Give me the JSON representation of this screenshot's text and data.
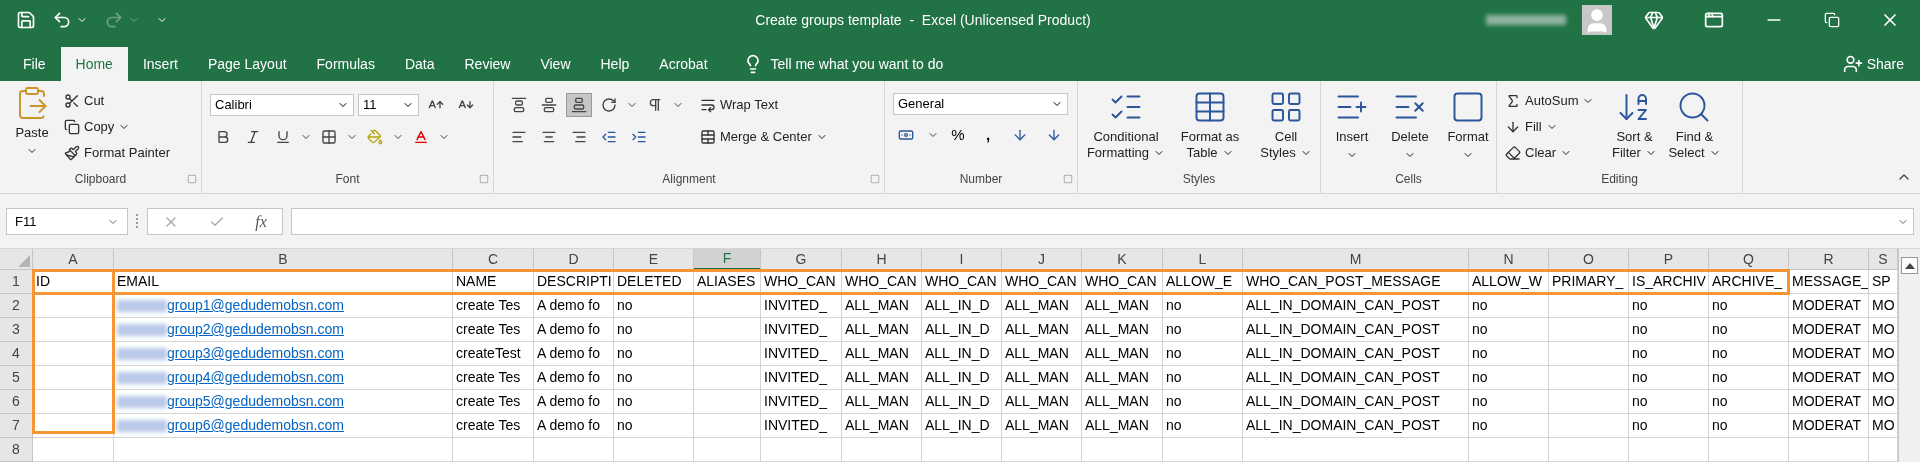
{
  "window": {
    "title": "Create groups template  -  Excel (Unlicensed Product)"
  },
  "quick_access": {
    "redo_disabled": true
  },
  "tabs": [
    {
      "label": "File",
      "selected": false
    },
    {
      "label": "Home",
      "selected": true
    },
    {
      "label": "Insert",
      "selected": false
    },
    {
      "label": "Page Layout",
      "selected": false
    },
    {
      "label": "Formulas",
      "selected": false
    },
    {
      "label": "Data",
      "selected": false
    },
    {
      "label": "Review",
      "selected": false
    },
    {
      "label": "View",
      "selected": false
    },
    {
      "label": "Help",
      "selected": false
    },
    {
      "label": "Acrobat",
      "selected": false
    }
  ],
  "tell_me": "Tell me what you want to do",
  "share": "Share",
  "clipboard": {
    "label": "Clipboard",
    "paste": "Paste",
    "cut": "Cut",
    "copy": "Copy",
    "format_painter": "Format Painter"
  },
  "font": {
    "label": "Font",
    "font_name": "Calibri",
    "font_size": "11"
  },
  "alignment": {
    "label": "Alignment",
    "wrap_text": "Wrap Text",
    "merge_center": "Merge & Center",
    "bottom_align_on": true
  },
  "number": {
    "label": "Number",
    "format": "General",
    "percent": "%",
    "comma": ","
  },
  "styles": {
    "label": "Styles",
    "buttons": [
      [
        "Conditional",
        "Formatting"
      ],
      [
        "Format as",
        "Table"
      ],
      [
        "Cell",
        "Styles"
      ]
    ]
  },
  "cells": {
    "label": "Cells",
    "buttons": [
      "Insert",
      "Delete",
      "Format"
    ]
  },
  "editing": {
    "label": "Editing",
    "autosum": "AutoSum",
    "fill": "Fill",
    "clear": "Clear",
    "sort": [
      "Sort &",
      "Filter"
    ],
    "find": [
      "Find &",
      "Select"
    ]
  },
  "formula_bar": {
    "name_box": "F11",
    "fx": "fx"
  },
  "sheet": {
    "columns": [
      {
        "letter": "A",
        "selected": false
      },
      {
        "letter": "B",
        "selected": false
      },
      {
        "letter": "C",
        "selected": false
      },
      {
        "letter": "D",
        "selected": false
      },
      {
        "letter": "E",
        "selected": false
      },
      {
        "letter": "F",
        "selected": true
      },
      {
        "letter": "G",
        "selected": false
      },
      {
        "letter": "H",
        "selected": false
      },
      {
        "letter": "I",
        "selected": false
      },
      {
        "letter": "J",
        "selected": false
      },
      {
        "letter": "K",
        "selected": false
      },
      {
        "letter": "L",
        "selected": false
      },
      {
        "letter": "M",
        "selected": false
      },
      {
        "letter": "N",
        "selected": false
      },
      {
        "letter": "O",
        "selected": false
      },
      {
        "letter": "P",
        "selected": false
      },
      {
        "letter": "Q",
        "selected": false
      },
      {
        "letter": "R",
        "selected": false
      },
      {
        "letter": "S",
        "selected": false
      }
    ],
    "rows": [
      {
        "number": "1",
        "cells": [
          "ID",
          "EMAIL",
          "NAME",
          "DESCRIPTI",
          "DELETED",
          "ALIASES",
          "WHO_CAN",
          "WHO_CAN",
          "WHO_CAN",
          "WHO_CAN",
          "WHO_CAN",
          "ALLOW_E",
          "WHO_CAN_POST_MESSAGE",
          "ALLOW_W",
          "PRIMARY_",
          "IS_ARCHIV",
          "ARCHIVE_",
          "MESSAGE_",
          "SP"
        ]
      },
      {
        "number": "2",
        "cells": [
          null,
          {
            "link": "group1@gedudemobsn.com"
          },
          "create Tes",
          "A demo fo",
          "no",
          null,
          "INVITED_",
          "ALL_MAN",
          "ALL_IN_D",
          "ALL_MAN",
          "ALL_MAN",
          "no",
          "ALL_IN_DOMAIN_CAN_POST",
          "no",
          null,
          "no",
          "no",
          "MODERAT",
          "MO"
        ]
      },
      {
        "number": "3",
        "cells": [
          null,
          {
            "link": "group2@gedudemobsn.com"
          },
          "create Tes",
          "A demo fo",
          "no",
          null,
          "INVITED_",
          "ALL_MAN",
          "ALL_IN_D",
          "ALL_MAN",
          "ALL_MAN",
          "no",
          "ALL_IN_DOMAIN_CAN_POST",
          "no",
          null,
          "no",
          "no",
          "MODERAT",
          "MO"
        ]
      },
      {
        "number": "4",
        "cells": [
          null,
          {
            "link": "group3@gedudemobsn.com"
          },
          "createTest",
          "A demo fo",
          "no",
          null,
          "INVITED_",
          "ALL_MAN",
          "ALL_IN_D",
          "ALL_MAN",
          "ALL_MAN",
          "no",
          "ALL_IN_DOMAIN_CAN_POST",
          "no",
          null,
          "no",
          "no",
          "MODERAT",
          "MO"
        ]
      },
      {
        "number": "5",
        "cells": [
          null,
          {
            "link": "group4@gedudemobsn.com"
          },
          "create Tes",
          "A demo fo",
          "no",
          null,
          "INVITED_",
          "ALL_MAN",
          "ALL_IN_D",
          "ALL_MAN",
          "ALL_MAN",
          "no",
          "ALL_IN_DOMAIN_CAN_POST",
          "no",
          null,
          "no",
          "no",
          "MODERAT",
          "MO"
        ]
      },
      {
        "number": "6",
        "cells": [
          null,
          {
            "link": "group5@gedudemobsn.com"
          },
          "create Tes",
          "A demo fo",
          "no",
          null,
          "INVITED_",
          "ALL_MAN",
          "ALL_IN_D",
          "ALL_MAN",
          "ALL_MAN",
          "no",
          "ALL_IN_DOMAIN_CAN_POST",
          "no",
          null,
          "no",
          "no",
          "MODERAT",
          "MO"
        ]
      },
      {
        "number": "7",
        "cells": [
          null,
          {
            "link": "group6@gedudemobsn.com"
          },
          "create Tes",
          "A demo fo",
          "no",
          null,
          "INVITED_",
          "ALL_MAN",
          "ALL_IN_D",
          "ALL_MAN",
          "ALL_MAN",
          "no",
          "ALL_IN_DOMAIN_CAN_POST",
          "no",
          null,
          "no",
          "no",
          "MODERAT",
          "MO"
        ]
      },
      {
        "number": "8",
        "cells": []
      }
    ]
  },
  "annotations": {
    "header_row_frame": true,
    "id_column_frame": true
  }
}
